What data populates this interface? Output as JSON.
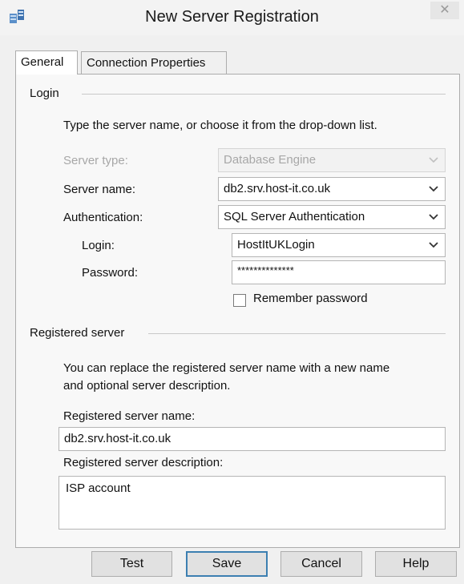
{
  "window": {
    "title": "New Server Registration",
    "close_glyph": "✕"
  },
  "tabs": [
    {
      "label": "General",
      "active": true
    },
    {
      "label": "Connection Properties",
      "active": false
    }
  ],
  "login_group": {
    "title": "Login",
    "instruction": "Type the server name, or choose it from the drop-down list.",
    "server_type_label": "Server type:",
    "server_type_value": "Database Engine",
    "server_name_label": "Server name:",
    "server_name_value": "db2.srv.host-it.co.uk",
    "authentication_label": "Authentication:",
    "authentication_value": "SQL Server Authentication",
    "login_label": "Login:",
    "login_value": "HostItUKLogin",
    "password_label": "Password:",
    "password_value": "**************",
    "remember_password_label": "Remember password",
    "remember_password_checked": false
  },
  "registered_group": {
    "title": "Registered server",
    "instruction_line1": "You can replace the registered server name with a new name",
    "instruction_line2": "and optional server description.",
    "name_label": "Registered server name:",
    "name_value": "db2.srv.host-it.co.uk",
    "description_label": "Registered server description:",
    "description_value": "ISP account"
  },
  "buttons": {
    "test": "Test",
    "save": "Save",
    "cancel": "Cancel",
    "help": "Help"
  },
  "icons": {
    "app": "server-registration-icon",
    "close": "close-icon",
    "dropdown": "chevron-down-icon"
  }
}
